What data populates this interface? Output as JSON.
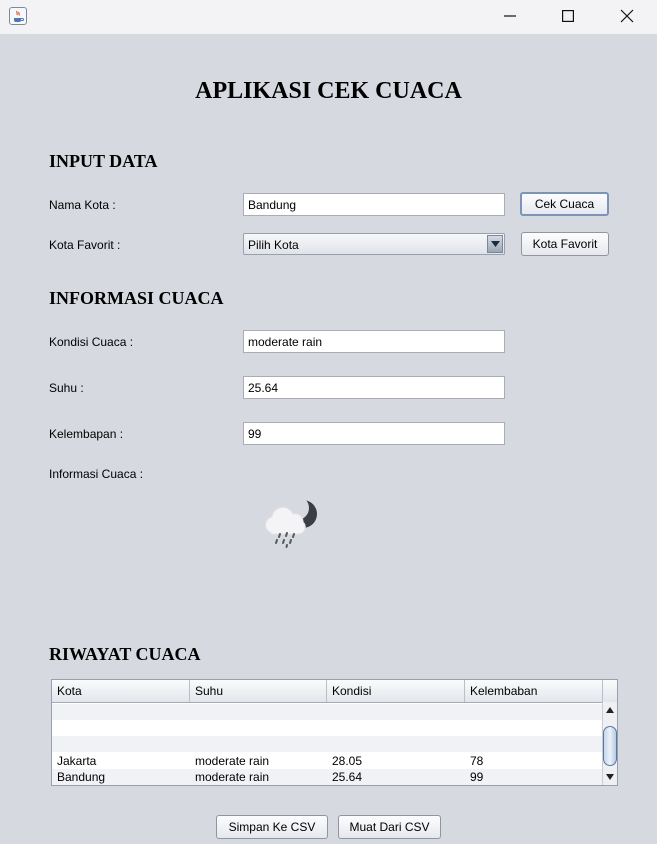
{
  "window": {
    "icon": "java-app-icon",
    "controls": [
      "minimize-icon",
      "maximize-icon",
      "close-icon"
    ]
  },
  "app_title": "APLIKASI CEK CUACA",
  "input_section": {
    "heading": "INPUT DATA",
    "city_label": "Nama Kota :",
    "city_value": "Bandung",
    "check_button": "Cek Cuaca",
    "favorite_label": "Kota Favorit :",
    "favorite_selected": "Pilih Kota",
    "favorite_button": "Kota Favorit"
  },
  "info_section": {
    "heading": "INFORMASI CUACA",
    "condition_label": "Kondisi Cuaca :",
    "condition_value": "moderate rain",
    "temp_label": "Suhu :",
    "temp_value": "25.64",
    "humidity_label": "Kelembapan :",
    "humidity_value": "99",
    "weather_info_label": "Informasi Cuaca :",
    "weather_icon": "cloud-rain-moon-icon"
  },
  "history_section": {
    "heading": "RIWAYAT CUACA",
    "columns": [
      "Kota",
      "Suhu",
      "Kondisi",
      "Kelembaban"
    ],
    "rows": [
      [
        "",
        "",
        "",
        ""
      ],
      [
        "",
        "",
        "",
        ""
      ],
      [
        "",
        "",
        "",
        ""
      ],
      [
        "Jakarta",
        "moderate rain",
        "28.05",
        "78"
      ],
      [
        "Bandung",
        "moderate rain",
        "25.64",
        "99"
      ]
    ]
  },
  "footer": {
    "save_button": "Simpan Ke CSV",
    "load_button": "Muat Dari CSV"
  },
  "colors": {
    "background": "#d6d9e0",
    "titlebar": "#f3f3f6"
  }
}
